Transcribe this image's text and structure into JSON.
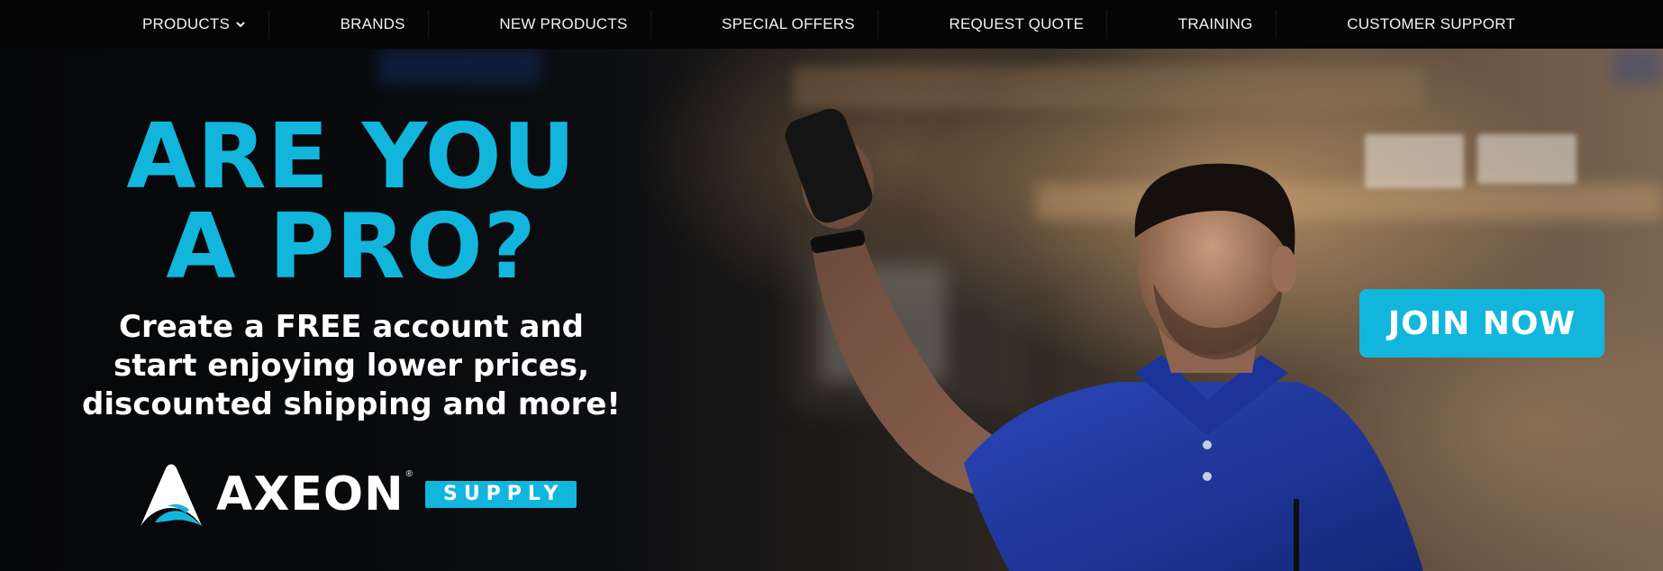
{
  "nav": {
    "items": [
      {
        "label": "PRODUCTS",
        "has_dropdown": true
      },
      {
        "label": "BRANDS"
      },
      {
        "label": "NEW PRODUCTS"
      },
      {
        "label": "SPECIAL OFFERS"
      },
      {
        "label": "REQUEST QUOTE"
      },
      {
        "label": "TRAINING"
      },
      {
        "label": "CUSTOMER SUPPORT"
      }
    ]
  },
  "hero": {
    "headline_line1": "ARE YOU",
    "headline_line2": "A PRO?",
    "sub_line1": "Create a FREE account and",
    "sub_line2": "start enjoying lower prices,",
    "sub_line3": "discounted shipping and more!",
    "cta_label": "JOIN NOW"
  },
  "logo": {
    "wordmark": "AXEON",
    "registered": "®",
    "tag": "SUPPLY"
  },
  "colors": {
    "accent": "#12b6dc",
    "nav_bg": "#050505",
    "shirt_blue": "#1f3aa8"
  },
  "icons": {
    "dropdown": "chevron-down-icon",
    "logo_mark": "axeon-logo-icon"
  }
}
